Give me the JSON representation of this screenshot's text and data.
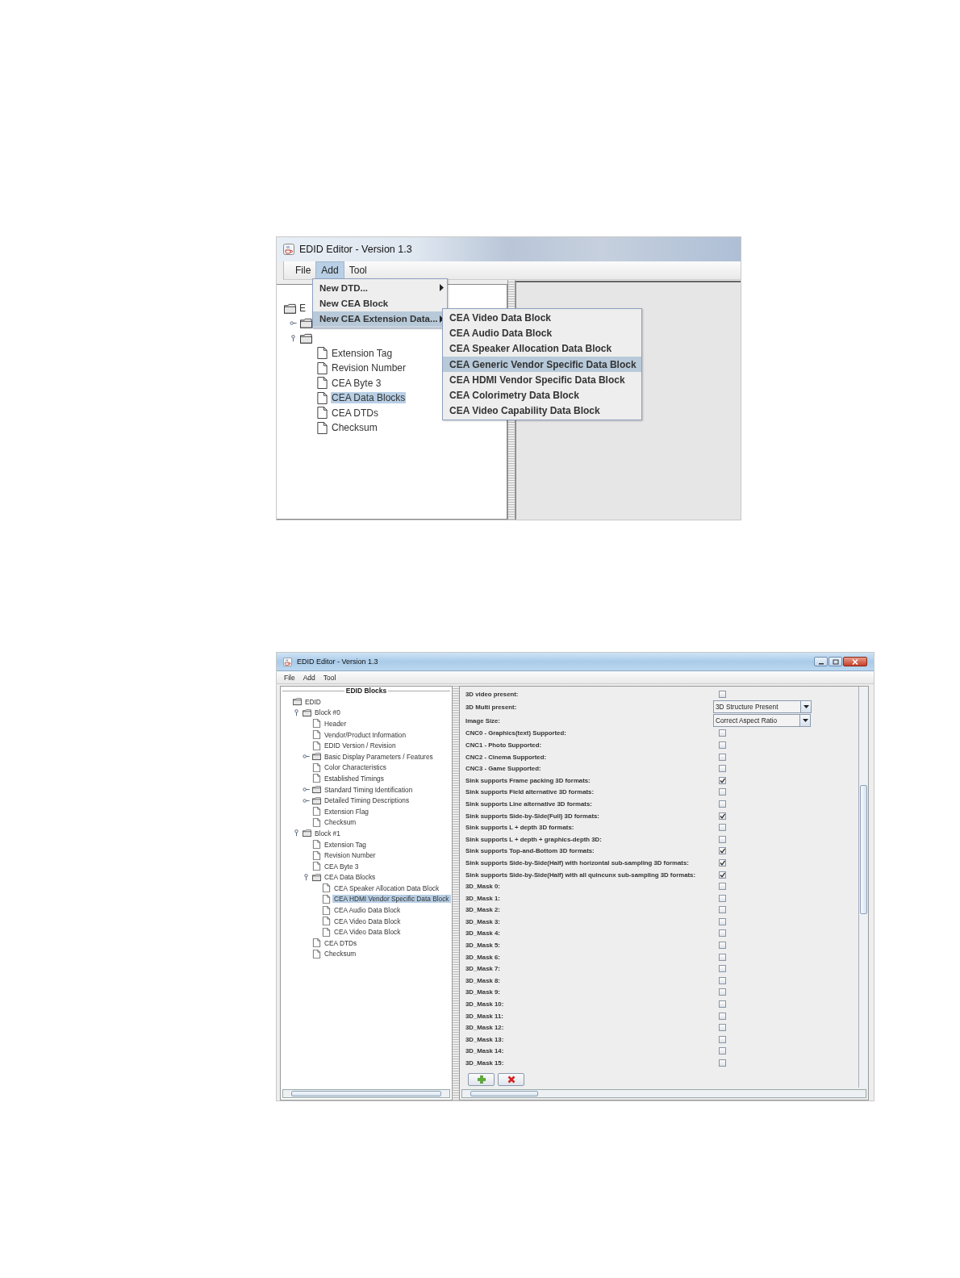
{
  "top_window": {
    "title": "EDID Editor - Version 1.3",
    "menu_bar": [
      {
        "label": "File",
        "selected": false
      },
      {
        "label": "Add",
        "selected": true
      },
      {
        "label": "Tool",
        "selected": false
      }
    ],
    "tree": [
      {
        "label": "E",
        "kind": "folder",
        "children": [
          {
            "kind": "folder",
            "expanded": false
          },
          {
            "kind": "folder",
            "expanded": true,
            "children": [
              {
                "label": "Extension Tag",
                "kind": "file",
                "selected": false
              },
              {
                "label": "Revision Number",
                "kind": "file",
                "selected": false
              },
              {
                "label": "CEA Byte 3",
                "kind": "file",
                "selected": false
              },
              {
                "label": "CEA Data Blocks",
                "kind": "file",
                "selected": true
              },
              {
                "label": "CEA DTDs",
                "kind": "file",
                "selected": false
              },
              {
                "label": "Checksum",
                "kind": "file",
                "selected": false
              }
            ]
          }
        ]
      }
    ],
    "add_menu": [
      {
        "label": "New DTD...",
        "submenu": true,
        "selected": false
      },
      {
        "label": "New CEA Block",
        "submenu": false,
        "selected": false
      },
      {
        "label": "New CEA Extension Data...",
        "submenu": true,
        "selected": true
      }
    ],
    "submenu": [
      {
        "label": "CEA Video Data Block",
        "selected": false
      },
      {
        "label": "CEA Audio Data Block",
        "selected": false
      },
      {
        "label": "CEA Speaker Allocation Data Block",
        "selected": false
      },
      {
        "label": "CEA Generic Vendor Specific Data Block",
        "selected": true
      },
      {
        "label": "CEA HDMI Vendor Specific Data Block",
        "selected": false
      },
      {
        "label": "CEA Colorimetry Data Block",
        "selected": false
      },
      {
        "label": "CEA Video Capability Data Block",
        "selected": false
      }
    ]
  },
  "bottom_window": {
    "title": "EDID Editor - Version 1.3",
    "menu_bar": [
      {
        "label": "File",
        "selected": false
      },
      {
        "label": "Add",
        "selected": false
      },
      {
        "label": "Tool",
        "selected": false
      }
    ],
    "tree_title": "EDID Blocks",
    "tree": [
      {
        "label": "EDID",
        "kind": "folder",
        "children": [
          {
            "label": "Block #0",
            "kind": "folder",
            "expanded": true,
            "children": [
              {
                "label": "Header",
                "kind": "file",
                "selected": false
              },
              {
                "label": "Vendor/Product Information",
                "kind": "file",
                "selected": false
              },
              {
                "label": "EDID Version / Revision",
                "kind": "file",
                "selected": false
              },
              {
                "label": "Basic Display Parameters / Features",
                "kind": "folder",
                "expanded": false
              },
              {
                "label": "Color Characteristics",
                "kind": "file",
                "selected": false
              },
              {
                "label": "Established Timings",
                "kind": "file",
                "selected": false
              },
              {
                "label": "Standard Timing Identification",
                "kind": "folder",
                "expanded": false
              },
              {
                "label": "Detailed Timing Descriptions",
                "kind": "folder",
                "expanded": false
              },
              {
                "label": "Extension Flag",
                "kind": "file",
                "selected": false
              },
              {
                "label": "Checksum",
                "kind": "file",
                "selected": false
              }
            ]
          },
          {
            "label": "Block #1",
            "kind": "folder",
            "expanded": true,
            "children": [
              {
                "label": "Extension Tag",
                "kind": "file",
                "selected": false
              },
              {
                "label": "Revision Number",
                "kind": "file",
                "selected": false
              },
              {
                "label": "CEA Byte 3",
                "kind": "file",
                "selected": false
              },
              {
                "label": "CEA Data Blocks",
                "kind": "folder",
                "expanded": true,
                "children": [
                  {
                    "label": "CEA Speaker Allocation Data Block",
                    "kind": "file",
                    "selected": false
                  },
                  {
                    "label": "CEA HDMI Vendor Specific Data Block",
                    "kind": "file",
                    "selected": true
                  },
                  {
                    "label": "CEA Audio Data Block",
                    "kind": "file",
                    "selected": false
                  },
                  {
                    "label": "CEA Video Data Block",
                    "kind": "file",
                    "selected": false
                  },
                  {
                    "label": "CEA Video Data Block",
                    "kind": "file",
                    "selected": false
                  }
                ]
              },
              {
                "label": "CEA DTDs",
                "kind": "file",
                "selected": false
              },
              {
                "label": "Checksum",
                "kind": "file",
                "selected": false
              }
            ]
          }
        ]
      }
    ],
    "fields": [
      {
        "label": "3D video present:",
        "kind": "checkbox",
        "checked": false
      },
      {
        "label": "3D Multi present:",
        "kind": "dropdown",
        "value": "3D Structure Present"
      },
      {
        "label": "Image Size:",
        "kind": "dropdown",
        "value": "Correct Aspect Ratio"
      },
      {
        "label": "CNC0 - Graphics(text) Supported:",
        "kind": "checkbox",
        "checked": false
      },
      {
        "label": "CNC1 - Photo Supported:",
        "kind": "checkbox",
        "checked": false
      },
      {
        "label": "CNC2 - Cinema Supported:",
        "kind": "checkbox",
        "checked": false
      },
      {
        "label": "CNC3 - Game Supported:",
        "kind": "checkbox",
        "checked": false
      },
      {
        "label": "Sink supports Frame packing 3D formats:",
        "kind": "checkbox",
        "checked": true
      },
      {
        "label": "Sink supports Field alternative 3D formats:",
        "kind": "checkbox",
        "checked": false
      },
      {
        "label": "Sink supports Line alternative 3D formats:",
        "kind": "checkbox",
        "checked": false
      },
      {
        "label": "Sink supports Side-by-Side(Full) 3D formats:",
        "kind": "checkbox",
        "checked": true
      },
      {
        "label": "Sink supports L + depth 3D formats:",
        "kind": "checkbox",
        "checked": false
      },
      {
        "label": "Sink supports L + depth + graphics-depth 3D:",
        "kind": "checkbox",
        "checked": false
      },
      {
        "label": "Sink supports Top-and-Bottom 3D formats:",
        "kind": "checkbox",
        "checked": true
      },
      {
        "label": "Sink supports Side-by-Side(Half) with horizontal sub-sampling 3D formats:",
        "kind": "checkbox",
        "checked": true
      },
      {
        "label": "Sink supports Side-by-Side(Half) with all quincunx sub-sampling 3D formats:",
        "kind": "checkbox",
        "checked": true
      },
      {
        "label": "3D_Mask 0:",
        "kind": "checkbox",
        "checked": false
      },
      {
        "label": "3D_Mask 1:",
        "kind": "checkbox",
        "checked": false
      },
      {
        "label": "3D_Mask 2:",
        "kind": "checkbox",
        "checked": false
      },
      {
        "label": "3D_Mask 3:",
        "kind": "checkbox",
        "checked": false
      },
      {
        "label": "3D_Mask 4:",
        "kind": "checkbox",
        "checked": false
      },
      {
        "label": "3D_Mask 5:",
        "kind": "checkbox",
        "checked": false
      },
      {
        "label": "3D_Mask 6:",
        "kind": "checkbox",
        "checked": false
      },
      {
        "label": "3D_Mask 7:",
        "kind": "checkbox",
        "checked": false
      },
      {
        "label": "3D_Mask 8:",
        "kind": "checkbox",
        "checked": false
      },
      {
        "label": "3D_Mask 9:",
        "kind": "checkbox",
        "checked": false
      },
      {
        "label": "3D_Mask 10:",
        "kind": "checkbox",
        "checked": false
      },
      {
        "label": "3D_Mask 11:",
        "kind": "checkbox",
        "checked": false
      },
      {
        "label": "3D_Mask 12:",
        "kind": "checkbox",
        "checked": false
      },
      {
        "label": "3D_Mask 13:",
        "kind": "checkbox",
        "checked": false
      },
      {
        "label": "3D_Mask 14:",
        "kind": "checkbox",
        "checked": false
      },
      {
        "label": "3D_Mask 15:",
        "kind": "checkbox",
        "checked": false
      }
    ],
    "buttons": [
      {
        "kind": "add"
      },
      {
        "kind": "delete"
      }
    ]
  }
}
